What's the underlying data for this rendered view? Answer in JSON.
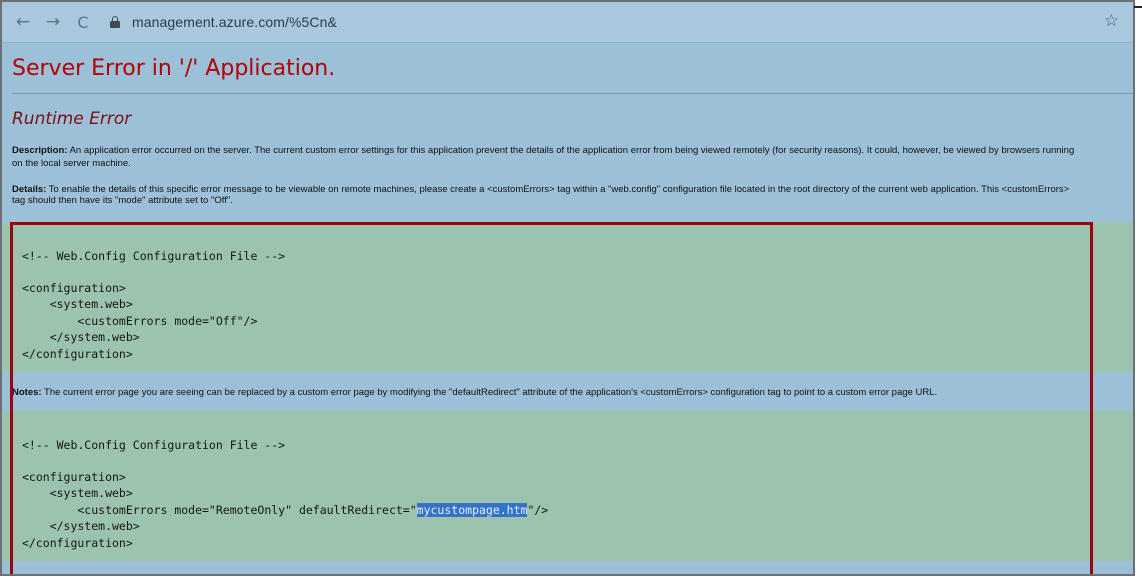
{
  "browser": {
    "url": "management.azure.com/%5Cn&",
    "back_glyph": "←",
    "forward_glyph": "→",
    "reload_glyph": "C",
    "star_glyph": "☆",
    "icons": [
      "back-arrow-icon",
      "forward-arrow-icon",
      "reload-icon",
      "lock-icon",
      "star-icon"
    ]
  },
  "page": {
    "title": "Server Error in '/' Application.",
    "subtitle": "Runtime Error",
    "description_label": "Description:",
    "description_text": " An application error occurred on the server. The current custom error settings for this application prevent the details of the application error from being viewed remotely (for security reasons). It could, however, be viewed by browsers running on the local server machine.",
    "description_line1": "An application error occurred on the server. The current custom error settings for this application prevent the details of the application error from being viewed remotely (for security reasons). It could, however, be viewed by browsers running",
    "description_line2": "on the local server machine.",
    "details_label": "Details:",
    "details_text": "To enable the details of this specific error message to be viewable on remote machines, please create a <customErrors> tag within a \"web.config\" configuration file located in the root directory of the current web application. This <customErrors> tag should then have its \"mode\" attribute set to \"Off\".",
    "details_line1": "To enable the details of this specific error message to be viewable on remote machines, please create a <customErrors> tag within a \"web.config\" configuration file located in the root directory of the current web application. This <customErrors>",
    "details_line2": "tag should then have its \"mode\" attribute set to \"Off\".",
    "code1": [
      "<!-- Web.Config Configuration File -->",
      "",
      "<configuration>",
      "    <system.web>",
      "        <customErrors mode=\"Off\"/>",
      "    </system.web>",
      "</configuration>"
    ],
    "notes_label": "Notes:",
    "notes_text": "The current error page you are seeing can be replaced by a custom error page by modifying the \"defaultRedirect\" attribute of the application's <customErrors> configuration tag to point to a custom error page URL.",
    "code2": [
      "<!-- Web.Config Configuration File -->",
      "",
      "<configuration>",
      "    <system.web>",
      "        <customErrors mode=\"RemoteOnly\" defaultRedirect=\"",
      "    </system.web>",
      "</configuration>"
    ],
    "code2_highlight": "mycustompage.htm",
    "code2_suffix": "\"/>"
  },
  "colors": {
    "title": "#b00000",
    "highlight_box": "#a0000c",
    "code_bg": "#9cc3ae",
    "page_bg": "#9cc0d8"
  }
}
